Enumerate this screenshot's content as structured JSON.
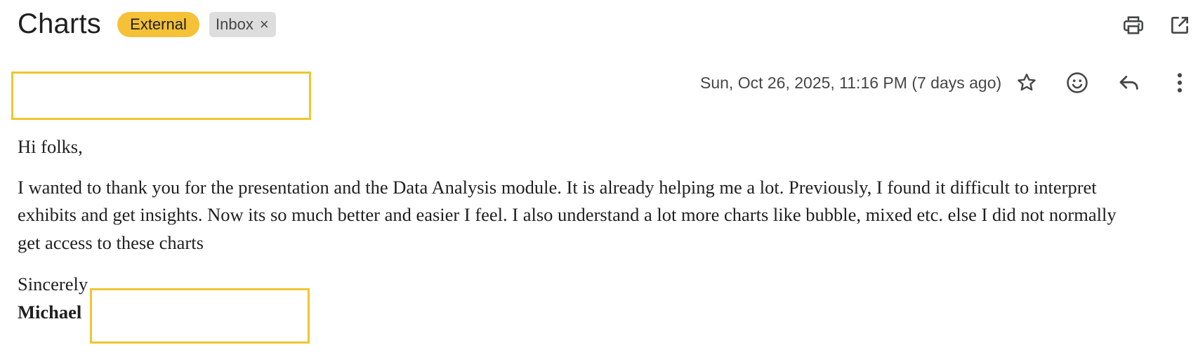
{
  "header": {
    "subject": "Charts",
    "labels": {
      "external": "External",
      "inbox": "Inbox",
      "inbox_remove": "×"
    },
    "icons": [
      "print-icon",
      "open-in-new-window-icon"
    ]
  },
  "message": {
    "date": "Sun, Oct 26, 2025, 11:16 PM (7 days ago)",
    "action_icons": [
      "star-icon",
      "emoji-icon",
      "reply-icon",
      "more-vert-icon"
    ],
    "body": {
      "greeting": "Hi folks,",
      "paragraph_lines": [
        "I wanted to thank you for the presentation and the Data Analysis module. It is already helping me a lot. Previously, I found it difficult to interpret",
        "exhibits and get insights. Now its so much better and easier I feel. I also understand a lot more charts like bubble, mixed etc. else I did not normally",
        "get access to these charts"
      ],
      "closing": "Sincerely",
      "signature": "Michael"
    }
  },
  "colors": {
    "external_chip": "#f4c137",
    "inbox_chip": "#dddddd",
    "redaction_border": "#f0c530",
    "icon": "#444746"
  }
}
